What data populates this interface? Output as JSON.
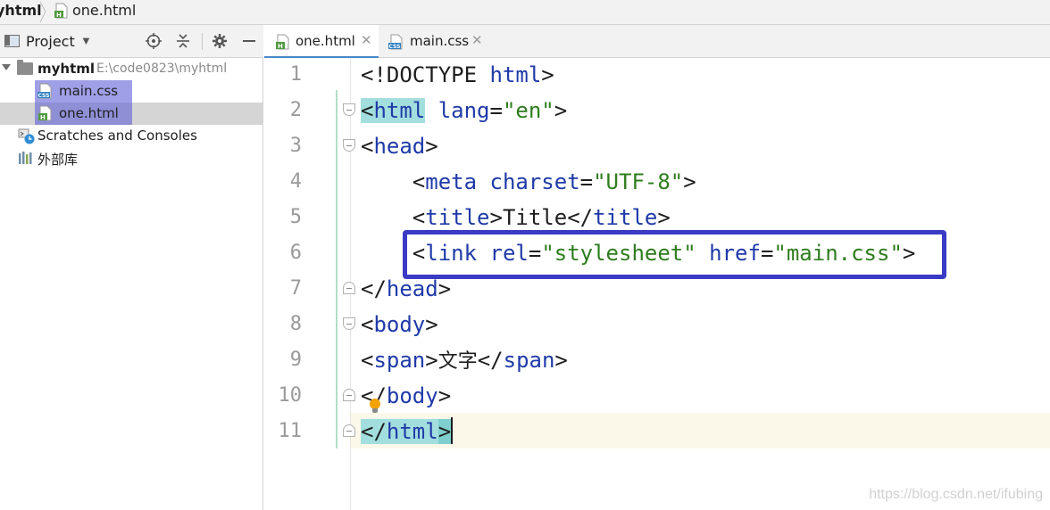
{
  "breadcrumb": {
    "root": "yhtml",
    "file": "one.html"
  },
  "project_panel": {
    "title": "Project",
    "dropdown_icon": "triangle-down",
    "buttons": [
      "crosshair-icon",
      "collapse-icon",
      "gear-icon",
      "minimize-icon"
    ],
    "tree": {
      "root_name": "myhtml",
      "root_path": "E:\\code0823\\myhtml",
      "files": [
        {
          "name": "main.css",
          "type": "css",
          "selected": false
        },
        {
          "name": "one.html",
          "type": "html",
          "selected": true
        }
      ],
      "scratches": "Scratches and Consoles",
      "libraries": "外部库"
    }
  },
  "tabs": [
    {
      "label": "one.html",
      "type": "html",
      "active": true
    },
    {
      "label": "main.css",
      "type": "css",
      "active": false
    }
  ],
  "editor": {
    "line_numbers": [
      "1",
      "2",
      "3",
      "4",
      "5",
      "6",
      "7",
      "8",
      "9",
      "10",
      "11"
    ],
    "current_line": 11,
    "lines": [
      [
        {
          "t": "<!DOCTYPE ",
          "c": "punct"
        },
        {
          "t": "html",
          "c": "tag"
        },
        {
          "t": ">",
          "c": "punct"
        }
      ],
      [
        {
          "t": "<",
          "c": "punct",
          "hl": 1
        },
        {
          "t": "html",
          "c": "tag",
          "hl": 1
        },
        {
          "t": " ",
          "c": "punct"
        },
        {
          "t": "lang",
          "c": "attr"
        },
        {
          "t": "=",
          "c": "punct"
        },
        {
          "t": "\"en\"",
          "c": "str"
        },
        {
          "t": ">",
          "c": "punct"
        }
      ],
      [
        {
          "t": "<",
          "c": "punct"
        },
        {
          "t": "head",
          "c": "tag"
        },
        {
          "t": ">",
          "c": "punct"
        }
      ],
      [
        {
          "t": "    <",
          "c": "punct"
        },
        {
          "t": "meta",
          "c": "tag"
        },
        {
          "t": " ",
          "c": "punct"
        },
        {
          "t": "charset",
          "c": "attr"
        },
        {
          "t": "=",
          "c": "punct"
        },
        {
          "t": "\"UTF-8\"",
          "c": "str"
        },
        {
          "t": ">",
          "c": "punct"
        }
      ],
      [
        {
          "t": "    <",
          "c": "punct"
        },
        {
          "t": "title",
          "c": "tag"
        },
        {
          "t": ">Title</",
          "c": "punct"
        },
        {
          "t": "title",
          "c": "tag"
        },
        {
          "t": ">",
          "c": "punct"
        }
      ],
      [
        {
          "t": "    <",
          "c": "punct"
        },
        {
          "t": "link",
          "c": "tag"
        },
        {
          "t": " ",
          "c": "punct"
        },
        {
          "t": "rel",
          "c": "attr"
        },
        {
          "t": "=",
          "c": "punct"
        },
        {
          "t": "\"stylesheet\"",
          "c": "str"
        },
        {
          "t": " ",
          "c": "punct"
        },
        {
          "t": "href",
          "c": "attr"
        },
        {
          "t": "=",
          "c": "punct"
        },
        {
          "t": "\"main.css\"",
          "c": "str"
        },
        {
          "t": ">",
          "c": "punct"
        }
      ],
      [
        {
          "t": "</",
          "c": "punct"
        },
        {
          "t": "head",
          "c": "tag"
        },
        {
          "t": ">",
          "c": "punct"
        }
      ],
      [
        {
          "t": "<",
          "c": "punct"
        },
        {
          "t": "body",
          "c": "tag"
        },
        {
          "t": ">",
          "c": "punct"
        }
      ],
      [
        {
          "t": "<",
          "c": "punct"
        },
        {
          "t": "span",
          "c": "tag"
        },
        {
          "t": ">",
          "c": "punct"
        },
        {
          "t": "文字",
          "c": "cjk"
        },
        {
          "t": "</",
          "c": "punct"
        },
        {
          "t": "span",
          "c": "tag"
        },
        {
          "t": ">",
          "c": "punct"
        }
      ],
      [
        {
          "t": "</",
          "c": "punct"
        },
        {
          "t": "body",
          "c": "tag"
        },
        {
          "t": ">",
          "c": "punct"
        }
      ],
      [
        {
          "t": "</",
          "c": "punct",
          "hl": 1
        },
        {
          "t": "html",
          "c": "tag",
          "hl": 1
        },
        {
          "t": ">",
          "c": "punct",
          "hl": 2
        },
        {
          "t": "",
          "c": "caret"
        }
      ]
    ],
    "highlighted_line": 6,
    "highlight_color": "#3a3ac4"
  },
  "watermark": "https://blog.csdn.net/ifubing"
}
